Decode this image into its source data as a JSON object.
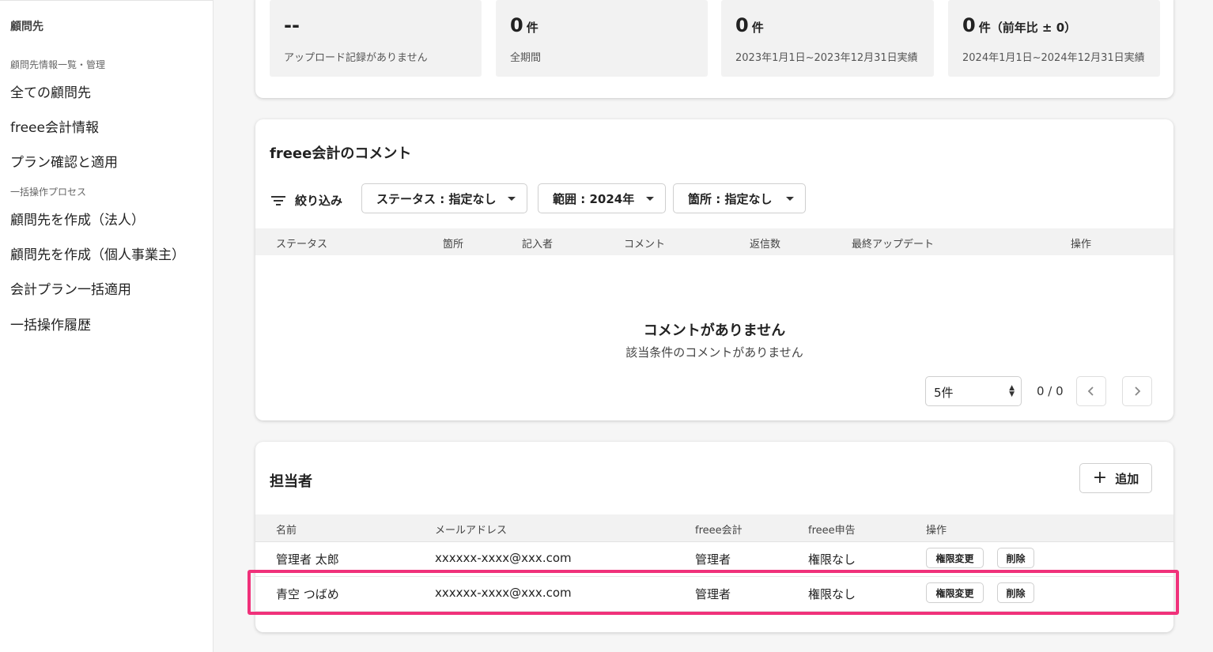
{
  "sidebar": {
    "title": "顧問先",
    "section1": "顧問先情報一覧・管理",
    "items1": [
      "全ての顧問先",
      "freee会計情報",
      "プラン確認と適用"
    ],
    "section2": "一括操作プロセス",
    "items2": [
      "顧問先を作成（法人）",
      "顧問先を作成（個人事業主）",
      "会計プラン一括適用",
      "一括操作履歴"
    ]
  },
  "stats": [
    {
      "value": "--",
      "unit": "",
      "label": "アップロード記録がありません"
    },
    {
      "value": "0",
      "unit": "件",
      "label": "全期間"
    },
    {
      "value": "0",
      "unit": "件",
      "label": "2023年1月1日~2023年12月31日実績"
    },
    {
      "value": "0",
      "unit": "件（前年比 ± 0）",
      "label": "2024年1月1日~2024年12月31日実績"
    }
  ],
  "comments": {
    "title": "freee会計のコメント",
    "filter_label": "絞り込み",
    "filters": [
      "ステータス : 指定なし",
      "範囲 : 2024年",
      "箇所 : 指定なし"
    ],
    "columns": [
      "ステータス",
      "箇所",
      "記入者",
      "コメント",
      "返信数",
      "最終アップデート",
      "操作"
    ],
    "empty_title": "コメントがありません",
    "empty_sub": "該当条件のコメントがありません",
    "page_size": "5件",
    "page_info": "0 / 0"
  },
  "staff": {
    "title": "担当者",
    "add_label": "追加",
    "columns": [
      "名前",
      "メールアドレス",
      "freee会計",
      "freee申告",
      "操作"
    ],
    "rows": [
      {
        "name": "管理者 太郎",
        "email": "xxxxxx-xxxx@xxx.com",
        "accounting": "管理者",
        "tax": "権限なし",
        "change": "権限変更",
        "delete": "削除"
      },
      {
        "name": "青空 つばめ",
        "email": "xxxxxx-xxxx@xxx.com",
        "accounting": "管理者",
        "tax": "権限なし",
        "change": "権限変更",
        "delete": "削除"
      }
    ]
  },
  "colors": {
    "highlight": "#f0317a",
    "background": "#f6f6f6"
  }
}
